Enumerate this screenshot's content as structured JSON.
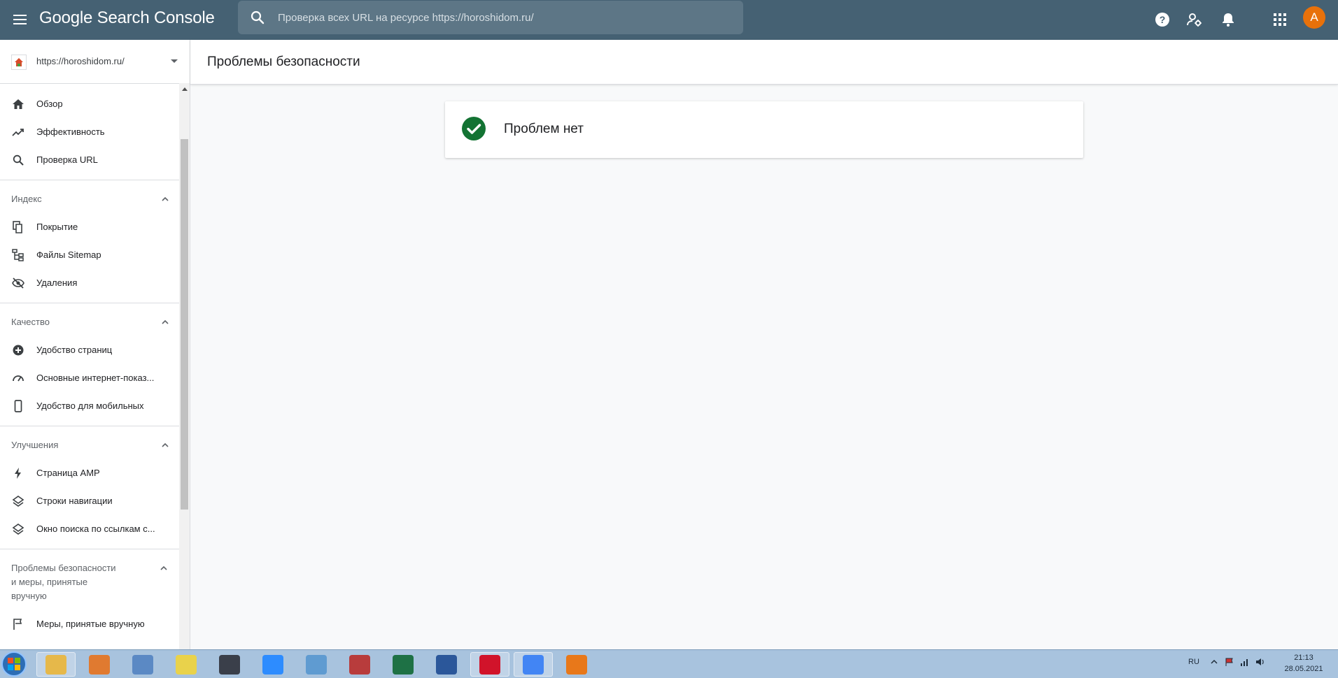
{
  "app": {
    "title": "Google Search Console"
  },
  "search": {
    "placeholder": "Проверка всех URL на ресурсе https://horoshidom.ru/"
  },
  "topbar": {
    "icons": [
      "help-icon",
      "account-settings-icon",
      "notifications-icon",
      "apps-grid-icon"
    ],
    "avatar_letter": "A",
    "avatar_color": "#e8710a",
    "bar_color": "#456173"
  },
  "sidebar": {
    "property_url": "https://horoshidom.ru/",
    "top_items": [
      {
        "label": "Обзор",
        "icon": "home-icon"
      },
      {
        "label": "Эффективность",
        "icon": "trending-up-icon"
      },
      {
        "label": "Проверка URL",
        "icon": "search-icon"
      }
    ],
    "sections": [
      {
        "title": "Индекс",
        "items": [
          {
            "label": "Покрытие",
            "icon": "file-copy-icon"
          },
          {
            "label": "Файлы Sitemap",
            "icon": "sitemap-icon"
          },
          {
            "label": "Удаления",
            "icon": "visibility-off-icon"
          }
        ]
      },
      {
        "title": "Качество",
        "items": [
          {
            "label": "Удобство страниц",
            "icon": "add-circle-icon"
          },
          {
            "label": "Основные интернет-показ...",
            "icon": "speed-gauge-icon"
          },
          {
            "label": "Удобство для мобильных",
            "icon": "smartphone-icon"
          }
        ]
      },
      {
        "title": "Улучшения",
        "items": [
          {
            "label": "Страница AMP",
            "icon": "bolt-icon"
          },
          {
            "label": "Строки навигации",
            "icon": "layers-icon"
          },
          {
            "label": "Окно поиска по ссылкам с...",
            "icon": "layers-icon"
          }
        ]
      },
      {
        "title": "Проблемы безопасности и меры, принятые вручную",
        "items": [
          {
            "label": "Меры, принятые вручную",
            "icon": "flag-icon"
          }
        ]
      }
    ]
  },
  "main": {
    "page_title": "Проблемы безопасности",
    "status_text": "Проблем нет",
    "status_color": "#137333"
  },
  "taskbar": {
    "apps": [
      {
        "name": "file-explorer",
        "color": "#e6b84a",
        "active": true
      },
      {
        "name": "media-player",
        "color": "#e07a30",
        "active": false
      },
      {
        "name": "calculator",
        "color": "#5b89c4",
        "active": false
      },
      {
        "name": "sticky-notes",
        "color": "#e9d24b",
        "active": false
      },
      {
        "name": "converter",
        "color": "#3a3f4a",
        "active": false
      },
      {
        "name": "zoom",
        "color": "#2d8cff",
        "active": false
      },
      {
        "name": "notepad",
        "color": "#5f9bd1",
        "active": false
      },
      {
        "name": "access",
        "color": "#b83c3c",
        "active": false
      },
      {
        "name": "excel",
        "color": "#1e7145",
        "active": false
      },
      {
        "name": "word",
        "color": "#2b579a",
        "active": false
      },
      {
        "name": "opera",
        "color": "#d1132a",
        "active": true
      },
      {
        "name": "chrome",
        "color": "#4285f4",
        "active": true
      },
      {
        "name": "faststone",
        "color": "#e8781a",
        "active": false
      }
    ],
    "language": "RU",
    "time": "21:13",
    "date": "28.05.2021"
  }
}
